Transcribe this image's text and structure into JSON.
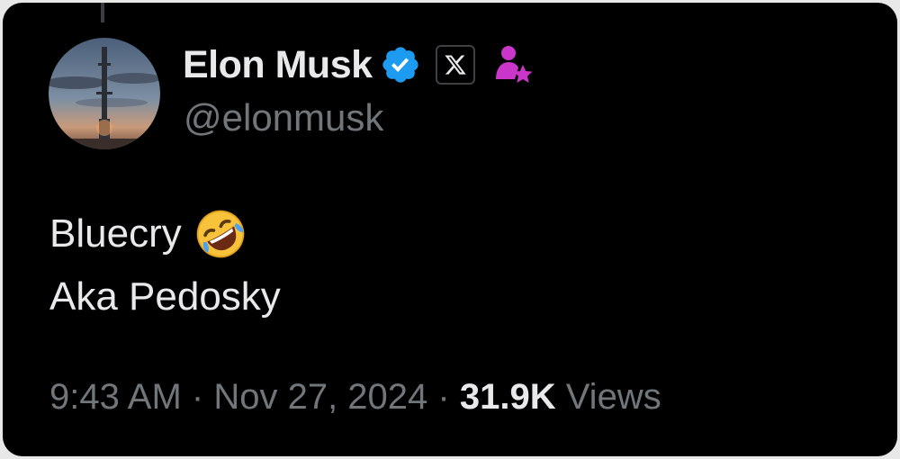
{
  "tweet": {
    "author": {
      "display_name": "Elon Musk",
      "handle": "@elonmusk",
      "verified_icon": "verified-badge-icon",
      "affiliation_icon": "x-logo-icon",
      "subscription_icon": "affiliate-star-icon"
    },
    "text_lines": [
      "Bluecry",
      "Aka Pedosky"
    ],
    "emoji": "rolling-on-floor-laughing",
    "time": "9:43 AM",
    "separator": "·",
    "date": "Nov 27, 2024",
    "views_count": "31.9K",
    "views_label": "Views"
  },
  "colors": {
    "background": "#000000",
    "primary_text": "#e7e9ea",
    "secondary_text": "#71767b",
    "verified_blue": "#1d9bf0",
    "affiliate_magenta": "#c936c9"
  }
}
